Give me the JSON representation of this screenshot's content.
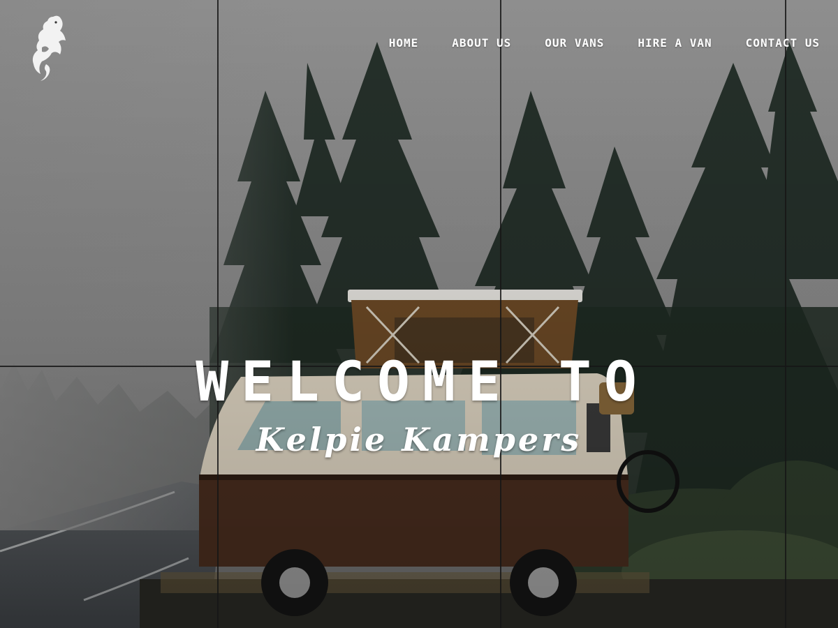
{
  "nav": {
    "items": [
      {
        "label": "HOME"
      },
      {
        "label": "ABOUT US"
      },
      {
        "label": "OUR VANS"
      },
      {
        "label": "HIRE A VAN"
      },
      {
        "label": "CONTACT US"
      }
    ]
  },
  "hero": {
    "headline": "WELCOME TO",
    "brand_name": "Kelpie Kampers"
  },
  "icons": {
    "logo": "kelpie-horse-logo-icon"
  },
  "colors": {
    "text": "#ffffff",
    "fog": "#8d8d8d",
    "forest": "#1f2a22",
    "van_brown": "#4a2e1f",
    "van_cream": "#e3d9c6"
  }
}
